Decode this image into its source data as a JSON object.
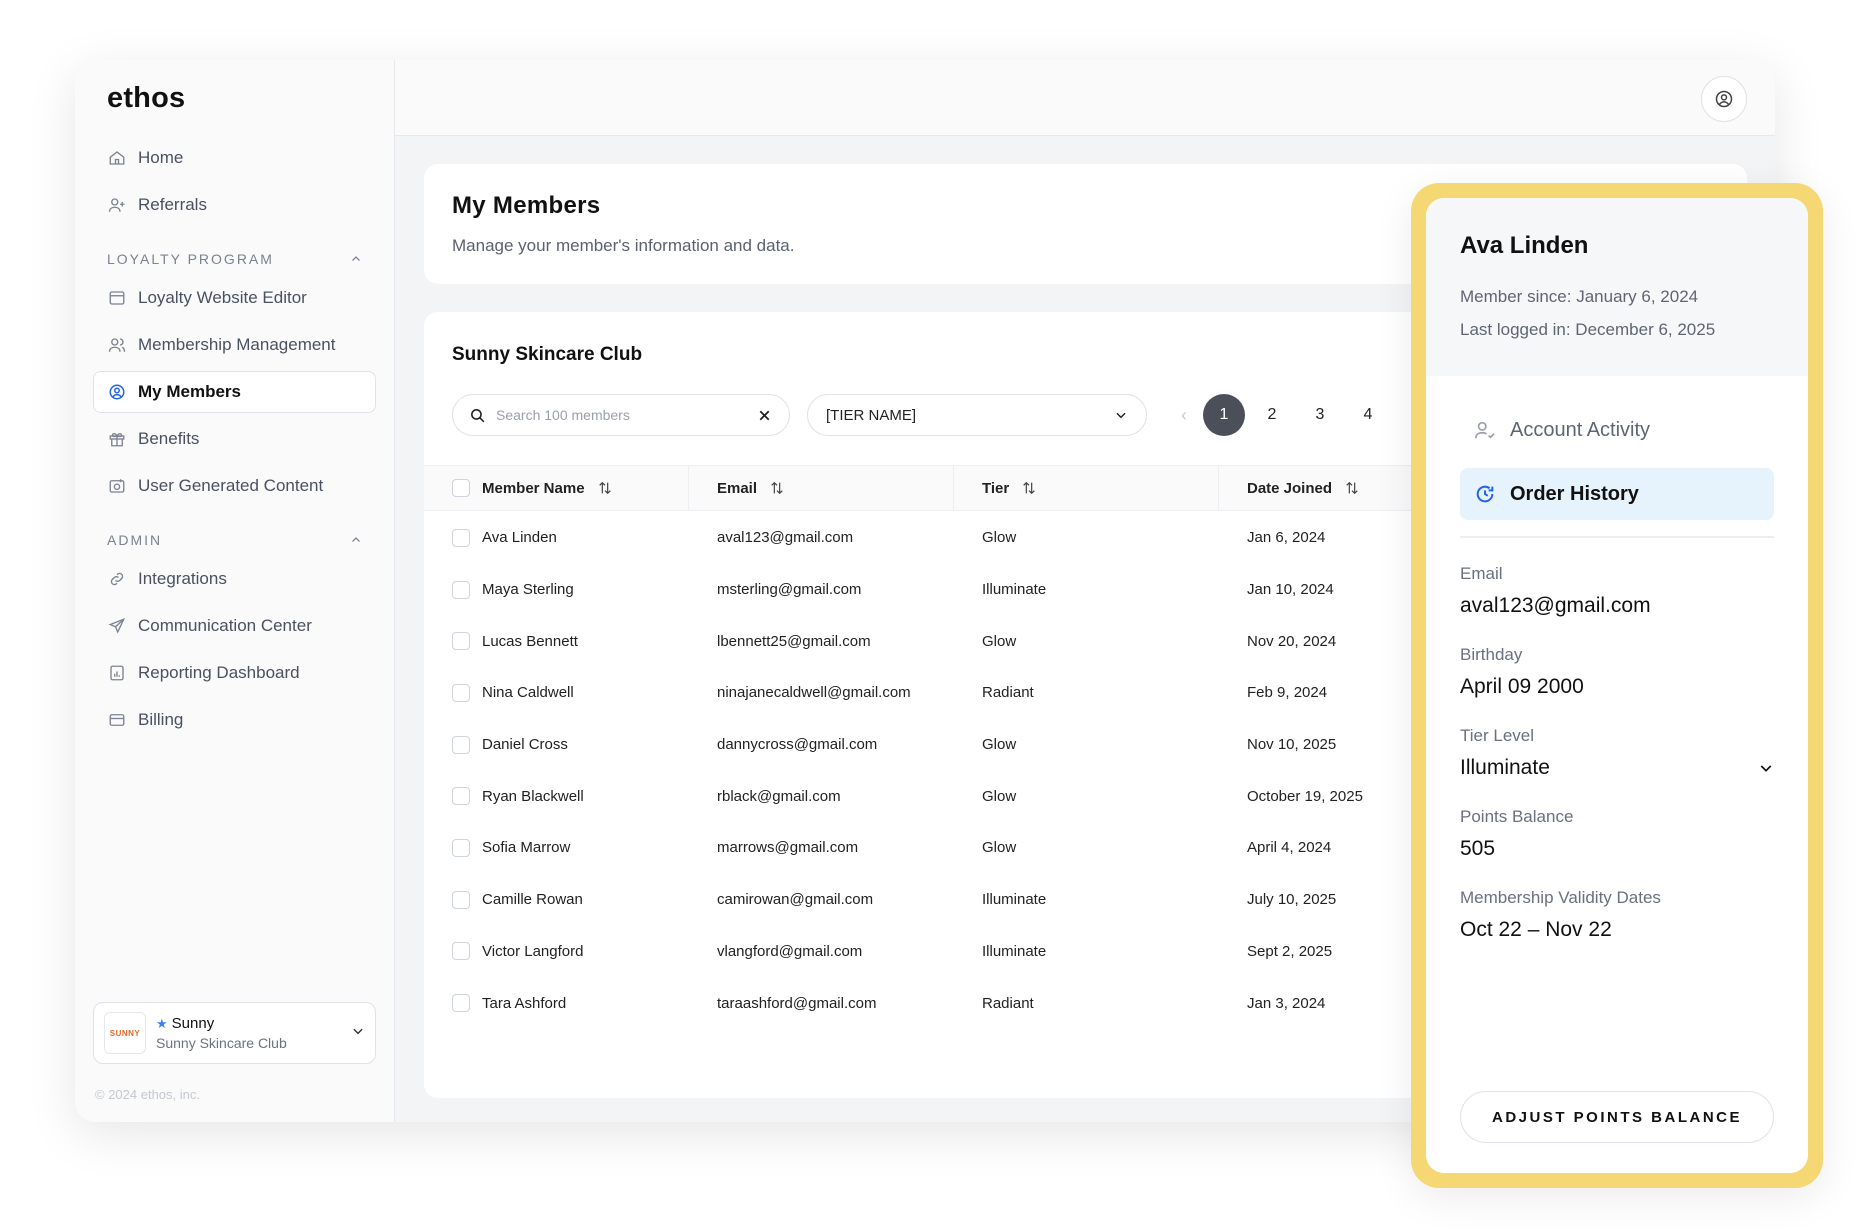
{
  "app": {
    "logo": "ethos"
  },
  "sidebar": {
    "top_items": [
      {
        "label": "Home",
        "icon": "home-icon"
      },
      {
        "label": "Referrals",
        "icon": "user-plus-icon"
      }
    ],
    "loyalty_section": "LOYALTY PROGRAM",
    "loyalty_items": [
      {
        "label": "Loyalty Website Editor",
        "icon": "browser-icon"
      },
      {
        "label": "Membership Management",
        "icon": "users-icon"
      },
      {
        "label": "My Members",
        "icon": "user-circle-icon",
        "active": true
      },
      {
        "label": "Benefits",
        "icon": "gift-icon"
      },
      {
        "label": "User Generated Content",
        "icon": "camera-icon"
      }
    ],
    "admin_section": "ADMIN",
    "admin_items": [
      {
        "label": "Integrations",
        "icon": "link-icon"
      },
      {
        "label": "Communication Center",
        "icon": "send-icon"
      },
      {
        "label": "Reporting Dashboard",
        "icon": "chart-icon"
      },
      {
        "label": "Billing",
        "icon": "credit-card-icon"
      }
    ],
    "workspace": {
      "logo_text": "SUNNY",
      "name": "Sunny",
      "sub": "Sunny Skincare Club"
    },
    "copyright": "© 2024 ethos, inc."
  },
  "header": {
    "title": "My Members",
    "subtitle": "Manage your member's information and data."
  },
  "table": {
    "club_title": "Sunny Skincare Club",
    "search_placeholder": "Search 100 members",
    "tier_filter": "[TIER NAME]",
    "pages": [
      "1",
      "2",
      "3",
      "4"
    ],
    "current_page": "1",
    "columns": [
      "Member Name",
      "Email",
      "Tier",
      "Date Joined"
    ],
    "rows": [
      {
        "name": "Ava Linden",
        "email": "aval123@gmail.com",
        "tier": "Glow",
        "joined": "Jan 6, 2024"
      },
      {
        "name": "Maya Sterling",
        "email": "msterling@gmail.com",
        "tier": "Illuminate",
        "joined": "Jan 10, 2024"
      },
      {
        "name": "Lucas Bennett",
        "email": "lbennett25@gmail.com",
        "tier": "Glow",
        "joined": "Nov 20, 2024"
      },
      {
        "name": "Nina Caldwell",
        "email": "ninajanecaldwell@gmail.com",
        "tier": "Radiant",
        "joined": "Feb 9, 2024"
      },
      {
        "name": "Daniel Cross",
        "email": "dannycross@gmail.com",
        "tier": "Glow",
        "joined": "Nov 10, 2025"
      },
      {
        "name": "Ryan Blackwell",
        "email": "rblack@gmail.com",
        "tier": "Glow",
        "joined": "October 19, 2025"
      },
      {
        "name": "Sofia Marrow",
        "email": "marrows@gmail.com",
        "tier": "Glow",
        "joined": "April 4, 2024"
      },
      {
        "name": "Camille Rowan",
        "email": "camirowan@gmail.com",
        "tier": "Illuminate",
        "joined": "July 10, 2025"
      },
      {
        "name": "Victor Langford",
        "email": "vlangford@gmail.com",
        "tier": "Illuminate",
        "joined": "Sept 2, 2025"
      },
      {
        "name": "Tara Ashford",
        "email": "taraashford@gmail.com",
        "tier": "Radiant",
        "joined": "Jan 3, 2024"
      }
    ]
  },
  "member_panel": {
    "name": "Ava Linden",
    "member_since": "Member since: January 6, 2024",
    "last_logged": "Last logged in: December 6, 2025",
    "tabs": [
      {
        "label": "Account Activity",
        "icon": "user-activity-icon"
      },
      {
        "label": "Order History",
        "icon": "clock-icon",
        "active": true
      }
    ],
    "fields": {
      "email_label": "Email",
      "email": "aval123@gmail.com",
      "birthday_label": "Birthday",
      "birthday": "April 09 2000",
      "tier_label": "Tier Level",
      "tier": "Illuminate",
      "points_label": "Points Balance",
      "points": "505",
      "validity_label": "Membership Validity Dates",
      "validity": "Oct 22 – Nov 22"
    },
    "adjust_button": "ADJUST POINTS BALANCE"
  },
  "colors": {
    "panel_border": "#f5d874",
    "active_tab_bg": "#e6f3fc",
    "current_page": "#4a4f5a",
    "accent_blue": "#3b82f6"
  }
}
